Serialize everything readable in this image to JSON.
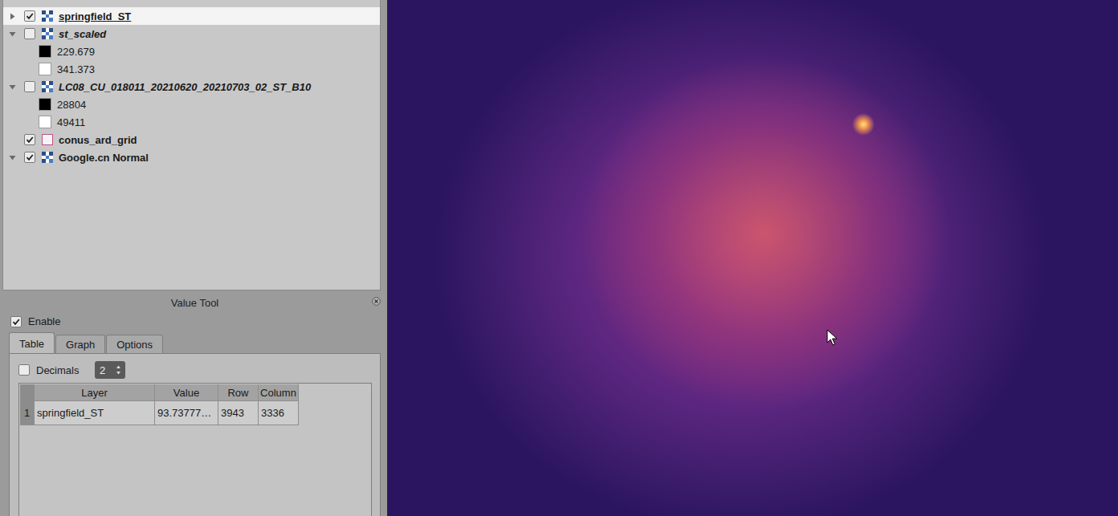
{
  "layers_panel": {
    "layers": [
      {
        "name": "springfield_ST",
        "checked": true,
        "expandable": true,
        "expanded": false,
        "selected": true,
        "kind": "raster",
        "legend": []
      },
      {
        "name": "st_scaled",
        "checked": false,
        "expandable": true,
        "expanded": true,
        "selected": false,
        "kind": "raster",
        "legend": [
          {
            "label": "229.679",
            "color": "#000000"
          },
          {
            "label": "341.373",
            "color": "#ffffff"
          }
        ]
      },
      {
        "name": "LC08_CU_018011_20210620_20210703_02_ST_B10",
        "checked": false,
        "expandable": true,
        "expanded": true,
        "selected": false,
        "kind": "raster",
        "legend": [
          {
            "label": "28804",
            "color": "#000000"
          },
          {
            "label": "49411",
            "color": "#ffffff"
          }
        ]
      },
      {
        "name": "conus_ard_grid",
        "checked": true,
        "expandable": false,
        "expanded": false,
        "selected": false,
        "kind": "vector",
        "legend": []
      },
      {
        "name": "Google.cn Normal",
        "checked": true,
        "expandable": true,
        "expanded": true,
        "selected": false,
        "kind": "raster",
        "legend": []
      }
    ]
  },
  "value_tool": {
    "title": "Value Tool",
    "enable": {
      "label": "Enable",
      "checked": true
    },
    "tabs": [
      {
        "label": "Table",
        "selected": true
      },
      {
        "label": "Graph",
        "selected": false
      },
      {
        "label": "Options",
        "selected": false
      }
    ],
    "decimals": {
      "label": "Decimals",
      "checked": false,
      "value": "2"
    },
    "table": {
      "columns": [
        "Layer",
        "Value",
        "Row",
        "Column"
      ],
      "rows": [
        {
          "index": "1",
          "cells": [
            "springfield_ST",
            "93.73777…",
            "3943",
            "3336"
          ]
        }
      ]
    }
  }
}
